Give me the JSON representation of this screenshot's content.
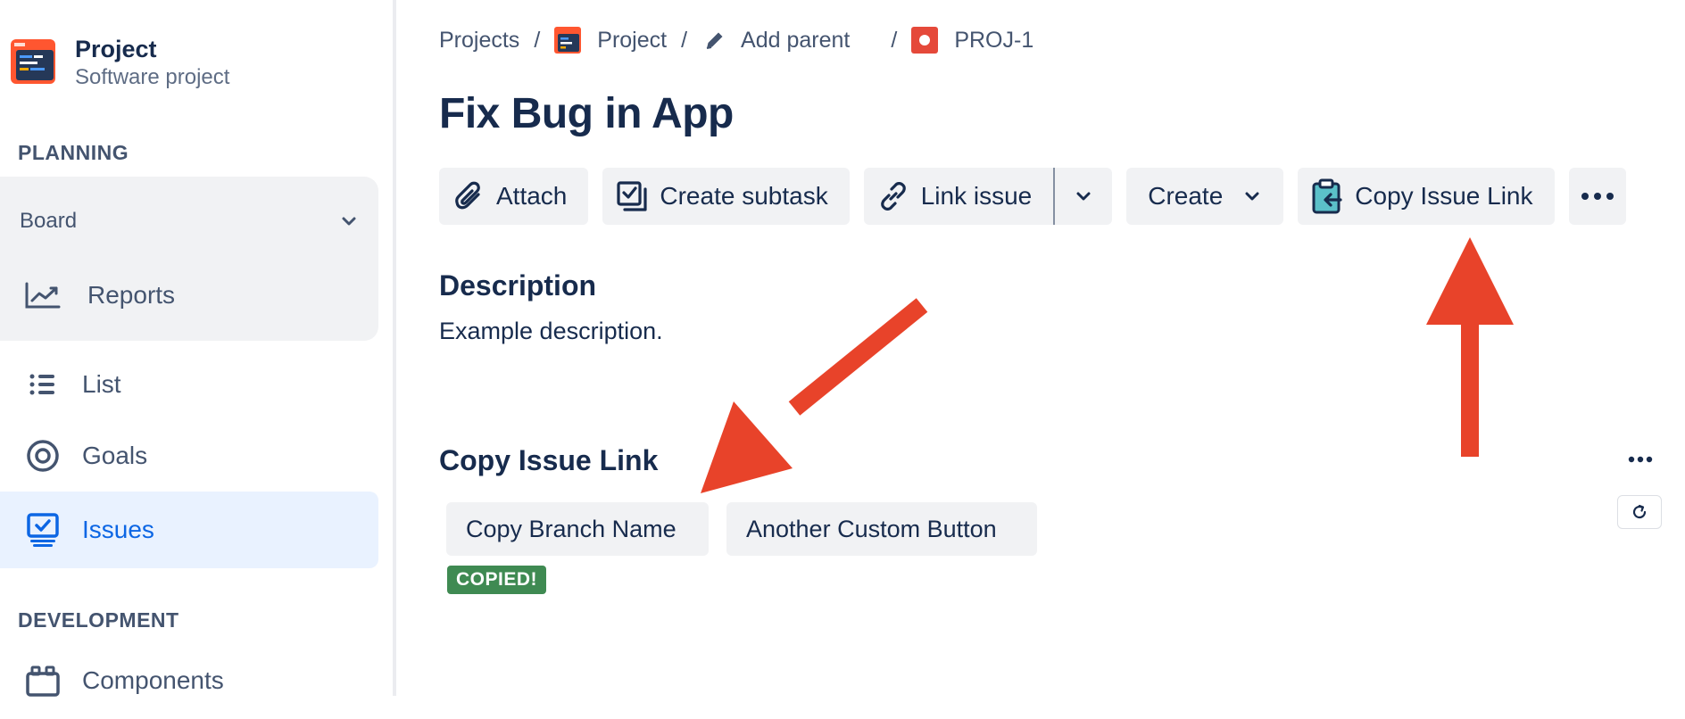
{
  "sidebar": {
    "project_name": "Project",
    "project_type": "Software project",
    "planning_label": "PLANNING",
    "board_label": "Board",
    "items": [
      {
        "label": "Reports",
        "icon": "chart-line-icon"
      },
      {
        "label": "List",
        "icon": "list-icon"
      },
      {
        "label": "Goals",
        "icon": "target-icon"
      },
      {
        "label": "Issues",
        "icon": "issues-icon",
        "active": true
      }
    ],
    "development_label": "DEVELOPMENT",
    "components_label": "Components"
  },
  "breadcrumb": {
    "projects": "Projects",
    "sep": "/",
    "project": "Project",
    "add_parent": "Add parent",
    "issue_key": "PROJ-1"
  },
  "issue": {
    "title": "Fix Bug in App",
    "description_heading": "Description",
    "description_text": "Example description."
  },
  "toolbar": {
    "attach": "Attach",
    "create_subtask": "Create subtask",
    "link_issue": "Link issue",
    "create": "Create",
    "copy_issue_link": "Copy Issue Link"
  },
  "panel": {
    "heading": "Copy Issue Link",
    "copy_branch": "Copy Branch Name",
    "another_button": "Another Custom Button",
    "copied_badge": "COPIED!"
  },
  "colors": {
    "accent_blue": "#0c66e4",
    "active_bg": "#e9f2ff",
    "button_bg": "#f1f2f4",
    "badge_green": "#3f8a52",
    "annotation_red": "#e8432a"
  }
}
